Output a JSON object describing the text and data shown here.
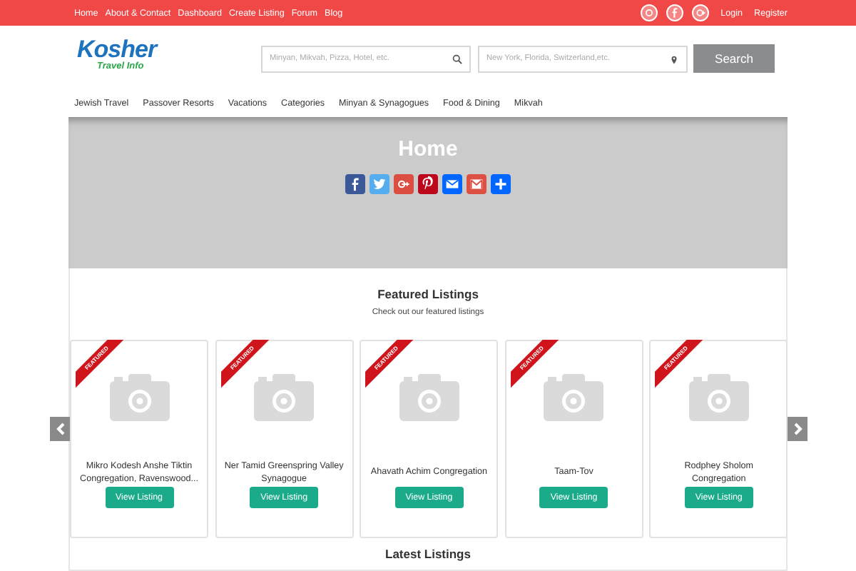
{
  "top_bar": {
    "links": [
      "Home",
      "About & Contact",
      "Dashboard",
      "Create Listing",
      "Forum",
      "Blog"
    ],
    "account_links": [
      "Login",
      "Register"
    ]
  },
  "header": {
    "logo": {
      "title": "Kosher",
      "subtitle": "Travel Info"
    },
    "search": {
      "placeholder": "Minyan, Mikvah, Pizza, Hotel, etc."
    },
    "location": {
      "placeholder": "New York, Florida, Switzerland,etc."
    },
    "button": "Search"
  },
  "nav": [
    "Jewish Travel",
    "Passover Resorts",
    "Vacations",
    "Categories",
    "Minyan & Synagogues",
    "Food & Dining",
    "Mikvah"
  ],
  "hero": {
    "title": "Home"
  },
  "featured": {
    "title": "Featured Listings",
    "subtitle": "Check out our featured listings",
    "listings": [
      {
        "name": "Mikro Kodesh Anshe Tiktin Congregation, Ravenswood...",
        "ribbon": "FEATURED",
        "button": "View Listing"
      },
      {
        "name": "Ner Tamid Greenspring Valley Synagogue",
        "ribbon": "FEATURED",
        "button": "View Listing"
      },
      {
        "name": "Ahavath Achim Congregation",
        "ribbon": "FEATURED",
        "button": "View Listing"
      },
      {
        "name": "Taam-Tov",
        "ribbon": "FEATURED",
        "button": "View Listing"
      },
      {
        "name": "Rodphey Sholom Congregation",
        "ribbon": "FEATURED",
        "button": "View Listing"
      }
    ]
  },
  "latest": {
    "title": "Latest Listings"
  }
}
